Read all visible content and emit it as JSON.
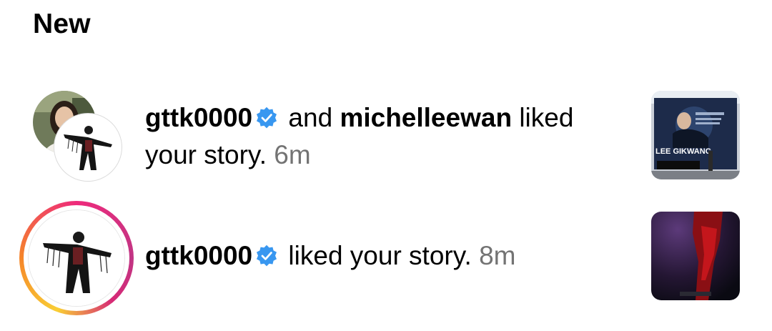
{
  "section": {
    "title": "New"
  },
  "notifications": [
    {
      "user1": "gttk0000",
      "connector": "and",
      "user2": "michelleewan",
      "action_a": "liked",
      "action_b": "your story.",
      "time": "6m",
      "thumbnail_icon": "story-thumbnail-billboard",
      "thumbnail_text": "LEE GIKWANG"
    },
    {
      "user1": "gttk0000",
      "action": "liked your story.",
      "time": "8m",
      "thumbnail_icon": "story-thumbnail-red-stage",
      "has_story_ring": true
    }
  ],
  "colors": {
    "verified": "#3897f0",
    "time": "#737373",
    "story_ring": [
      "#f9ce34",
      "#ee2a7b",
      "#c13584"
    ]
  }
}
